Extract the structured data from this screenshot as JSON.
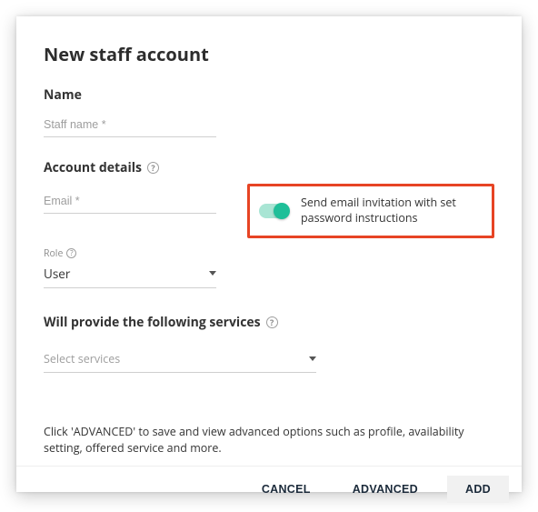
{
  "dialog": {
    "title": "New staff account"
  },
  "sections": {
    "name_label": "Name",
    "account_label": "Account details",
    "services_label": "Will provide the following services",
    "role_tiny_label": "Role"
  },
  "fields": {
    "staff_name_placeholder": "Staff name *",
    "email_placeholder": "Email *",
    "role_value": "User",
    "services_placeholder": "Select services"
  },
  "toggle": {
    "label": "Send email invitation with set password instructions",
    "state": true
  },
  "hint": {
    "text": "Click 'ADVANCED' to save and view advanced options such as profile, availability setting, offered service and more."
  },
  "footer": {
    "cancel": "CANCEL",
    "advanced": "ADVANCED",
    "add": "ADD"
  },
  "icons": {
    "help_glyph": "?"
  }
}
